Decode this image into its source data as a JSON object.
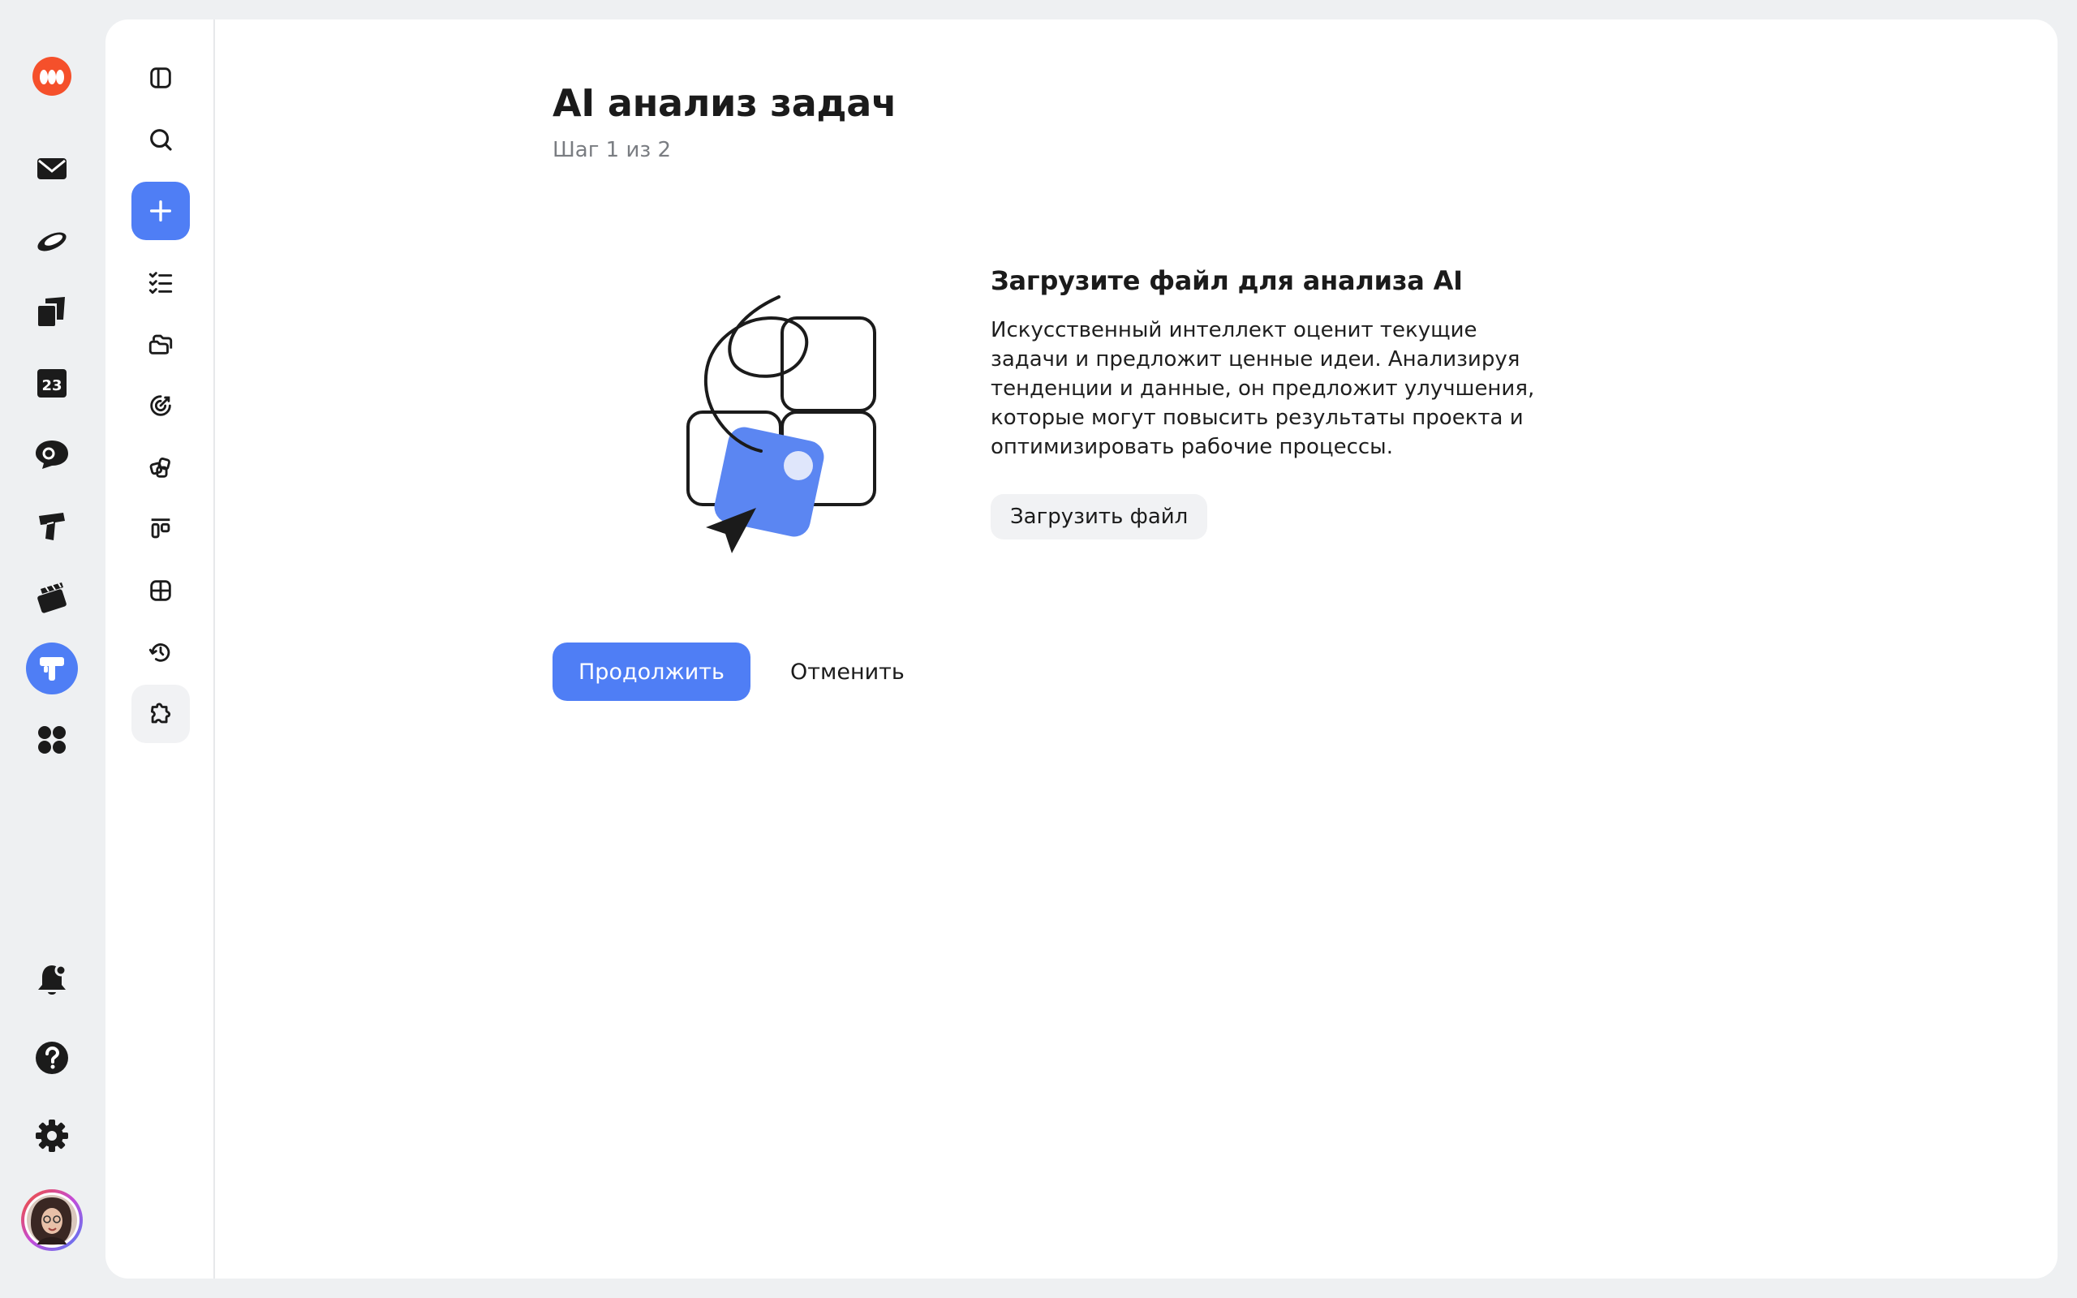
{
  "page": {
    "title": "AI анализ задач",
    "step": "Шаг 1 из 2"
  },
  "upload": {
    "title": "Загрузите файл для анализа AI",
    "description": "Искусственный интеллект оценит текущие задачи и предложит ценные идеи. Анализируя тенденции и данные, он предложит улучшения, которые могут повысить результаты проекта и оптимизировать рабочие процессы.",
    "button_label": "Загрузить файл"
  },
  "actions": {
    "continue_label": "Продолжить",
    "cancel_label": "Отменить"
  },
  "app_rail": {
    "items": [
      {
        "icon": "logo-icon"
      },
      {
        "icon": "mail-icon"
      },
      {
        "icon": "disk-icon"
      },
      {
        "icon": "documents-icon"
      },
      {
        "icon": "calendar-icon",
        "label": "23"
      },
      {
        "icon": "messenger-icon"
      },
      {
        "icon": "tracker-icon"
      },
      {
        "icon": "video-icon"
      },
      {
        "icon": "tasks-app-icon",
        "active": true
      },
      {
        "icon": "apps-grid-icon"
      },
      {
        "icon": "notifications-icon"
      },
      {
        "icon": "help-icon"
      },
      {
        "icon": "settings-icon"
      },
      {
        "icon": "avatar"
      }
    ]
  },
  "tool_rail": {
    "items": [
      {
        "icon": "sidebar-toggle-icon"
      },
      {
        "icon": "search-icon"
      },
      {
        "icon": "plus-icon",
        "primary": true
      },
      {
        "icon": "task-list-icon"
      },
      {
        "icon": "folders-icon"
      },
      {
        "icon": "goals-icon"
      },
      {
        "icon": "components-icon"
      },
      {
        "icon": "board-icon"
      },
      {
        "icon": "table-icon"
      },
      {
        "icon": "history-icon"
      },
      {
        "icon": "plugins-icon",
        "active": true
      }
    ]
  },
  "colors": {
    "accent": "#4f7ef5",
    "background": "#eef0f2",
    "brand": "#f5502b"
  }
}
